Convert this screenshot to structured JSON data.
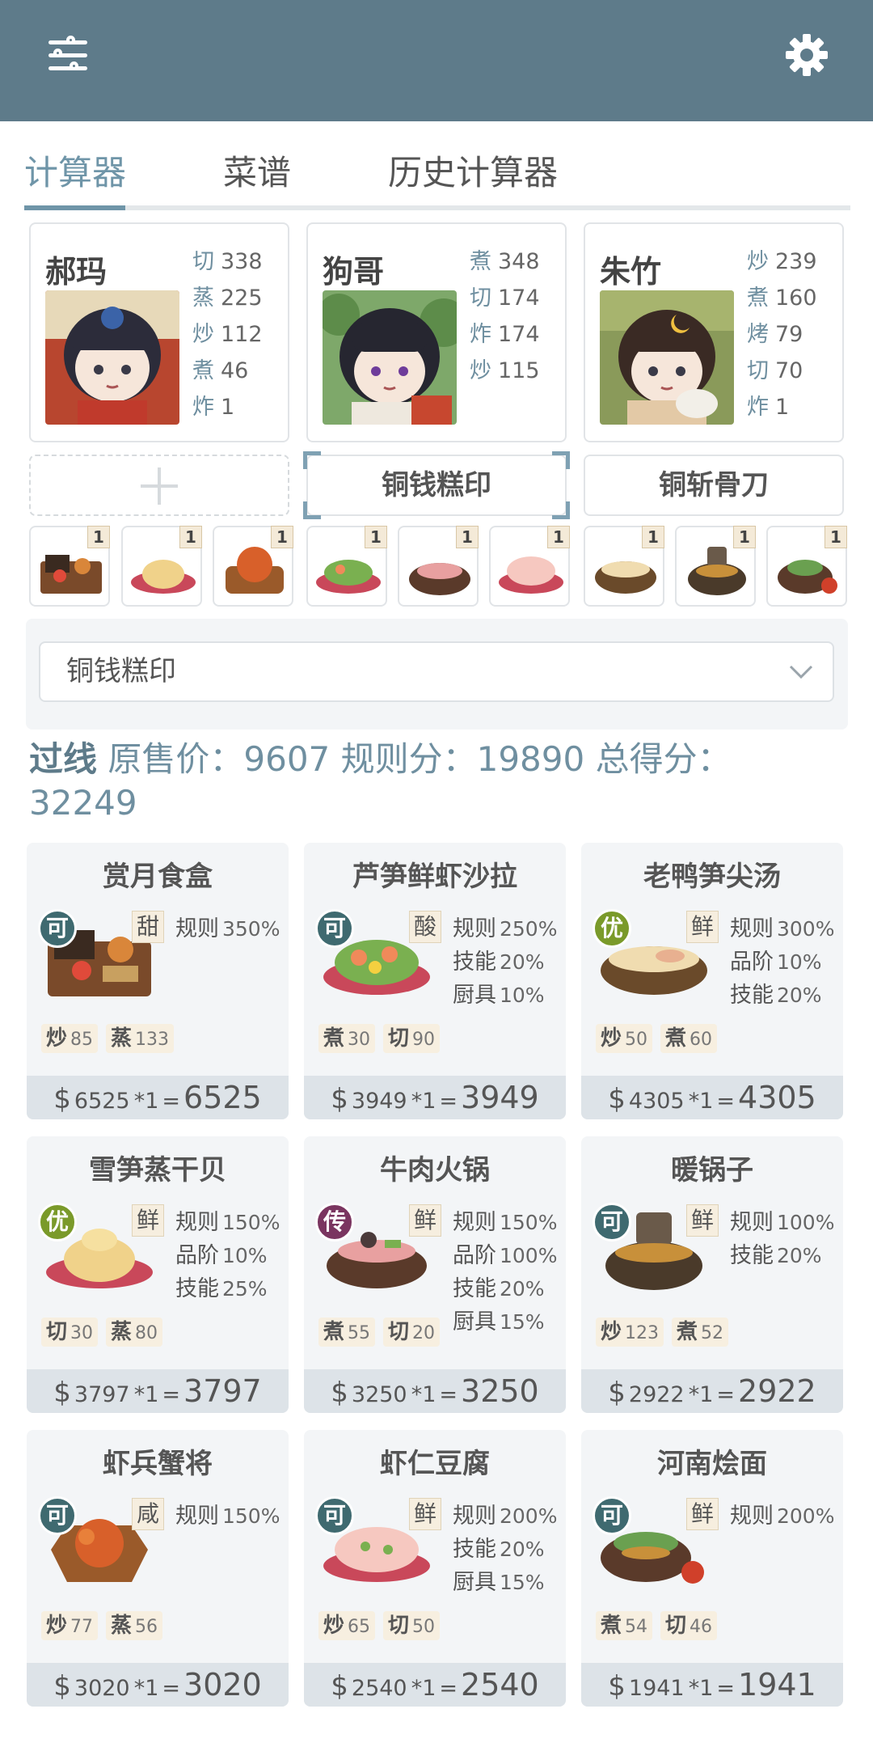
{
  "tabs": [
    "计算器",
    "菜谱",
    "历史计算器"
  ],
  "chefs": [
    {
      "name": "郝玛",
      "skills": [
        [
          "切",
          "338"
        ],
        [
          "蒸",
          "225"
        ],
        [
          "炒",
          "112"
        ],
        [
          "煮",
          "46"
        ],
        [
          "炸",
          "1"
        ]
      ]
    },
    {
      "name": "狗哥",
      "skills": [
        [
          "煮",
          "348"
        ],
        [
          "切",
          "174"
        ],
        [
          "炸",
          "174"
        ],
        [
          "炒",
          "115"
        ]
      ]
    },
    {
      "name": "朱竹",
      "skills": [
        [
          "炒",
          "239"
        ],
        [
          "煮",
          "160"
        ],
        [
          "烤",
          "79"
        ],
        [
          "切",
          "70"
        ],
        [
          "炸",
          "1"
        ]
      ]
    }
  ],
  "equipment": [
    "",
    "铜钱糕印",
    "铜斩骨刀"
  ],
  "recipe_quantities": [
    "1",
    "1",
    "1",
    "1",
    "1",
    "1",
    "1",
    "1",
    "1"
  ],
  "selected_equipment": "铜钱糕印",
  "summary": {
    "pass": "过线",
    "text1": "原售价：9607 规则分：19890 总得分：",
    "text2": "32249"
  },
  "cards": [
    {
      "title": "赏月食盒",
      "grade": "可",
      "taste": "甜",
      "rules": [
        [
          "规则",
          "350%"
        ]
      ],
      "req": [
        [
          "炒",
          "85"
        ],
        [
          "蒸",
          "133"
        ]
      ],
      "base": "6525",
      "mul": "*1",
      "total": "6525"
    },
    {
      "title": "芦笋鲜虾沙拉",
      "grade": "可",
      "taste": "酸",
      "rules": [
        [
          "规则",
          "250%"
        ],
        [
          "技能",
          "20%"
        ],
        [
          "厨具",
          "10%"
        ]
      ],
      "req": [
        [
          "煮",
          "30"
        ],
        [
          "切",
          "90"
        ]
      ],
      "base": "3949",
      "mul": "*1",
      "total": "3949"
    },
    {
      "title": "老鸭笋尖汤",
      "grade": "优",
      "taste": "鲜",
      "rules": [
        [
          "规则",
          "300%"
        ],
        [
          "品阶",
          "10%"
        ],
        [
          "技能",
          "20%"
        ]
      ],
      "req": [
        [
          "炒",
          "50"
        ],
        [
          "煮",
          "60"
        ]
      ],
      "base": "4305",
      "mul": "*1",
      "total": "4305"
    },
    {
      "title": "雪笋蒸干贝",
      "grade": "优",
      "taste": "鲜",
      "rules": [
        [
          "规则",
          "150%"
        ],
        [
          "品阶",
          "10%"
        ],
        [
          "技能",
          "25%"
        ]
      ],
      "req": [
        [
          "切",
          "30"
        ],
        [
          "蒸",
          "80"
        ]
      ],
      "base": "3797",
      "mul": "*1",
      "total": "3797"
    },
    {
      "title": "牛肉火锅",
      "grade": "传",
      "taste": "鲜",
      "rules": [
        [
          "规则",
          "150%"
        ],
        [
          "品阶",
          "100%"
        ],
        [
          "技能",
          "20%"
        ],
        [
          "厨具",
          "15%"
        ]
      ],
      "req": [
        [
          "煮",
          "55"
        ],
        [
          "切",
          "20"
        ]
      ],
      "base": "3250",
      "mul": "*1",
      "total": "3250"
    },
    {
      "title": "暖锅子",
      "grade": "可",
      "taste": "鲜",
      "rules": [
        [
          "规则",
          "100%"
        ],
        [
          "技能",
          "20%"
        ]
      ],
      "req": [
        [
          "炒",
          "123"
        ],
        [
          "煮",
          "52"
        ]
      ],
      "base": "2922",
      "mul": "*1",
      "total": "2922"
    },
    {
      "title": "虾兵蟹将",
      "grade": "可",
      "taste": "咸",
      "rules": [
        [
          "规则",
          "150%"
        ]
      ],
      "req": [
        [
          "炒",
          "77"
        ],
        [
          "蒸",
          "56"
        ]
      ],
      "base": "3020",
      "mul": "*1",
      "total": "3020"
    },
    {
      "title": "虾仁豆腐",
      "grade": "可",
      "taste": "鲜",
      "rules": [
        [
          "规则",
          "200%"
        ],
        [
          "技能",
          "20%"
        ],
        [
          "厨具",
          "15%"
        ]
      ],
      "req": [
        [
          "炒",
          "65"
        ],
        [
          "切",
          "50"
        ]
      ],
      "base": "2540",
      "mul": "*1",
      "total": "2540"
    },
    {
      "title": "河南烩面",
      "grade": "可",
      "taste": "鲜",
      "rules": [
        [
          "规则",
          "200%"
        ]
      ],
      "req": [
        [
          "煮",
          "54"
        ],
        [
          "切",
          "46"
        ]
      ],
      "base": "1941",
      "mul": "*1",
      "total": "1941"
    }
  ],
  "currency_symbol": "$",
  "price_eq": "=",
  "colors": {
    "header": "#5e7b8a",
    "accent": "#6f95a8",
    "grade_ke": "#3f6a70",
    "grade_you": "#7a9a2a",
    "grade_chuan": "#7a3560"
  },
  "icons": {
    "menu": "sliders-icon",
    "settings": "gear-icon",
    "dropdown": "chevron-down-icon",
    "add": "plus-icon"
  }
}
